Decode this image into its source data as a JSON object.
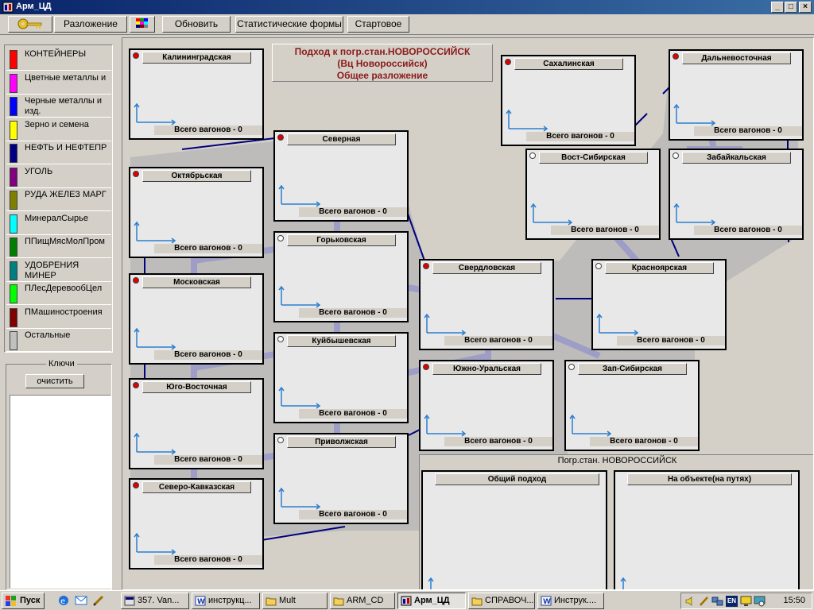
{
  "window": {
    "title": "Арм_ЦД"
  },
  "toolbar": {
    "buttons": [
      "Разложение",
      "Обновить",
      "Статистические формы",
      "Стартовое"
    ],
    "key_icon": "key-icon",
    "palette_icon": "color-palette-icon"
  },
  "legend": [
    {
      "label": "КОНТЕЙНЕРЫ",
      "color": "#ff0000"
    },
    {
      "label": "Цветные металлы и",
      "color": "#ff00ff"
    },
    {
      "label": "Черные металлы и изд.",
      "color": "#0000ff"
    },
    {
      "label": "Зерно и семена",
      "color": "#ffff00"
    },
    {
      "label": "НЕФТЬ И НЕФТЕПР",
      "color": "#000080"
    },
    {
      "label": "УГОЛЬ",
      "color": "#800080"
    },
    {
      "label": "РУДА ЖЕЛЕЗ МАРГ",
      "color": "#808000"
    },
    {
      "label": "МинералСырье",
      "color": "#00ffff"
    },
    {
      "label": "ППищМясМолПром",
      "color": "#008000"
    },
    {
      "label": "УДОБРЕНИЯ МИНЕР",
      "color": "#008080"
    },
    {
      "label": "ПЛесДеревообЦел",
      "color": "#00ff00"
    },
    {
      "label": "ПМашиностроения",
      "color": "#800000"
    },
    {
      "label": "Остальные",
      "color": "#c0c0c0"
    }
  ],
  "keys": {
    "title": "Ключи",
    "clear": "очистить"
  },
  "header": {
    "line1": "Подход к погр.стан.НОВОРОССИЙСК",
    "line2": "(Вц Новороссийск)",
    "line3": "Общее разложение"
  },
  "stations": [
    {
      "name": "Калининградская",
      "dot": "red",
      "total": "Всего вагонов - 0"
    },
    {
      "name": "Октябрьская",
      "dot": "red",
      "total": "Всего вагонов - 0"
    },
    {
      "name": "Московская",
      "dot": "red",
      "total": "Всего вагонов - 0"
    },
    {
      "name": "Юго-Восточная",
      "dot": "red",
      "total": "Всего вагонов - 0"
    },
    {
      "name": "Северо-Кавказская",
      "dot": "red",
      "total": "Всего вагонов - 0"
    },
    {
      "name": "Северная",
      "dot": "red",
      "total": "Всего вагонов - 0"
    },
    {
      "name": "Горьковская",
      "dot": "white",
      "total": "Всего вагонов - 0"
    },
    {
      "name": "Куйбышевская",
      "dot": "white",
      "total": "Всего вагонов - 0"
    },
    {
      "name": "Приволжская",
      "dot": "white",
      "total": "Всего вагонов - 0"
    },
    {
      "name": "Свердловская",
      "dot": "red",
      "total": "Всего вагонов - 0"
    },
    {
      "name": "Южно-Уральская",
      "dot": "red",
      "total": "Всего вагонов - 0"
    },
    {
      "name": "Сахалинская",
      "dot": "red",
      "total": "Всего вагонов - 0"
    },
    {
      "name": "Вост-Сибирская",
      "dot": "white",
      "total": "Всего вагонов - 0"
    },
    {
      "name": "Дальневосточная",
      "dot": "red",
      "total": "Всего вагонов - 0"
    },
    {
      "name": "Забайкальская",
      "dot": "white",
      "total": "Всего вагонов - 0"
    },
    {
      "name": "Красноярская",
      "dot": "white",
      "total": "Всего вагонов - 0"
    },
    {
      "name": "Зап-Сибирская",
      "dot": "white",
      "total": "Всего вагонов - 0"
    }
  ],
  "destination": {
    "title": "Погр.стан. НОВОРОССИЙСК",
    "panels": [
      "Общий подход",
      "На объекте(на путях)"
    ]
  },
  "taskbar": {
    "start": "Пуск",
    "tasks": [
      "357. Van...",
      "инструкц...",
      "Mult",
      "ARM_CD",
      "Арм_ЦД",
      "СПРАВОЧ...",
      "Инструк...."
    ],
    "active_task": "Арм_ЦД",
    "clock": "15:50",
    "lang": "EN"
  }
}
